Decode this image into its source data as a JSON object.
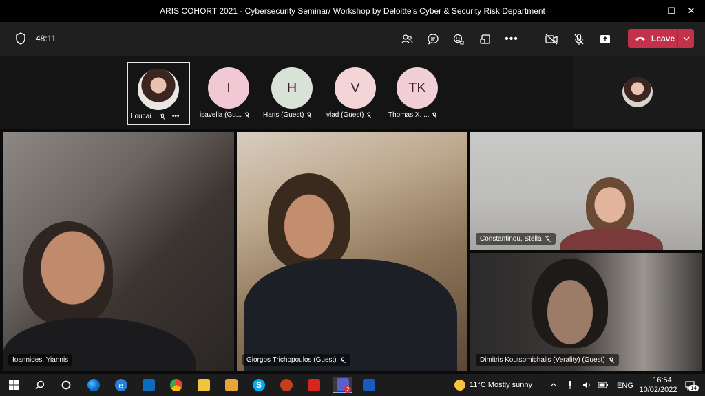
{
  "window": {
    "title": "ARIS COHORT 2021 - Cybersecurity Seminar/ Workshop by Deloitte's Cyber & Security Risk Department",
    "minimize_glyph": "—",
    "maximize_glyph": "☐",
    "close_glyph": "✕"
  },
  "meeting": {
    "timer": "48:11",
    "leave_label": "Leave"
  },
  "participants": [
    {
      "name": "Loucai...",
      "initials": "",
      "color": "#d8d3cf",
      "photo": true
    },
    {
      "name": "isavella (Gu...",
      "initials": "I",
      "color": "#f1c9d5"
    },
    {
      "name": "Haris (Guest)",
      "initials": "H",
      "color": "#d9e2d6"
    },
    {
      "name": "vlad (Guest)",
      "initials": "V",
      "color": "#f3d5d8"
    },
    {
      "name": "Thomas X. ...",
      "initials": "TK",
      "color": "#f2cfd6"
    }
  ],
  "tiles": [
    {
      "name": "Ioannides, Yiannis"
    },
    {
      "name": "Giorgos Trichopoulos (Guest)"
    },
    {
      "name": "Constantinou, Stella"
    },
    {
      "name": "Dimitris Koutsomichalis (Verality) (Guest)"
    }
  ],
  "taskbar": {
    "weather": "11°C  Mostly sunny",
    "language": "ENG",
    "time": "16:54",
    "date": "10/02/2022",
    "notifications_count": "14",
    "teams_badge": "2"
  }
}
